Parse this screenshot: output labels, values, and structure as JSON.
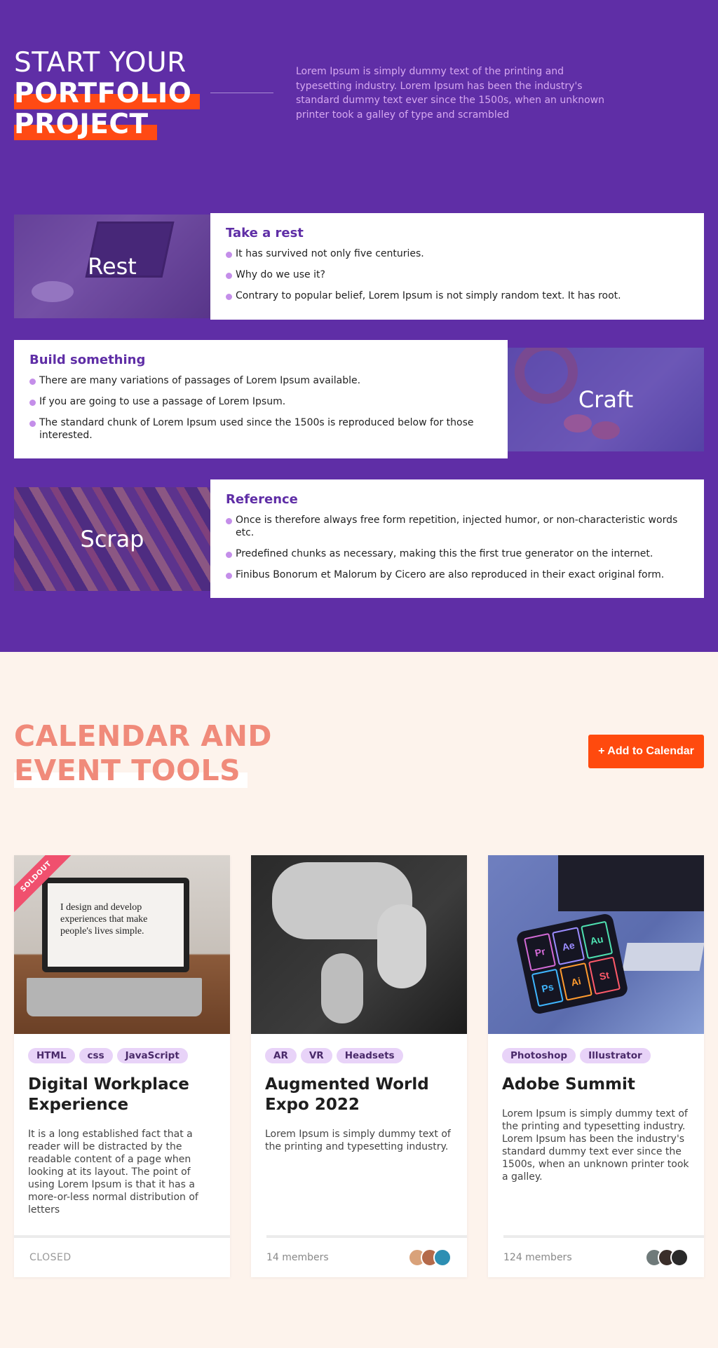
{
  "hero": {
    "title_line1": "START YOUR",
    "title_line2": "PORTFOLIO",
    "title_line3": "PROJECT",
    "description": "Lorem Ipsum is simply dummy text of the printing and typesetting industry. Lorem Ipsum has been the industry's standard dummy text ever since the 1500s, when an unknown printer took a galley of type and scrambled"
  },
  "features": [
    {
      "image_label": "Rest",
      "title": "Take a rest",
      "items": [
        "It has survived not only five centuries.",
        "Why do we use it?",
        "Contrary to popular belief, Lorem Ipsum is not simply random text. It has root."
      ]
    },
    {
      "image_label": "Craft",
      "title": "Build something",
      "items": [
        "There are many variations of passages of Lorem Ipsum available.",
        "If you are going to use a passage of Lorem Ipsum.",
        "The standard chunk of Lorem Ipsum used since the 1500s is reproduced below for those interested."
      ]
    },
    {
      "image_label": "Scrap",
      "title": "Reference",
      "items": [
        "Once is therefore always free form repetition, injected humor, or non-characteristic words etc.",
        "Predefined chunks as necessary, making this the first true generator on the internet.",
        "Finibus Bonorum et Malorum by Cicero are also reproduced in their exact original form."
      ]
    }
  ],
  "calendar": {
    "title_line1": "CALENDAR AND",
    "title_line2": "EVENT TOOLS",
    "add_button": "+ Add to Calendar"
  },
  "events": [
    {
      "ribbon": "SOLDOUT",
      "screen_text": "I design and develop experiences that make people's lives simple.",
      "tags": [
        "HTML",
        "css",
        "JavaScript"
      ],
      "title": "Digital Workplace Experience",
      "description": "It is a long established fact that a reader will be distracted by the readable content of a page when looking at its layout. The point of using Lorem Ipsum is that it has a more-or-less normal distribution of letters",
      "footer": "CLOSED"
    },
    {
      "tags": [
        "AR",
        "VR",
        "Headsets"
      ],
      "title": "Augmented World Expo 2022",
      "description": "Lorem Ipsum is simply dummy text of the printing and typesetting industry.",
      "footer": "14 members"
    },
    {
      "tags": [
        "Photoshop",
        "Illustrator"
      ],
      "title": "Adobe Summit",
      "description": "Lorem Ipsum is simply dummy text of the printing and typesetting industry. Lorem Ipsum has been the industry's standard dummy text ever since the 1500s, when an unknown printer took a galley.",
      "footer": "124 members",
      "app_tiles": [
        "Pr",
        "Ae",
        "Au",
        "Ps",
        "Ai",
        "St"
      ]
    }
  ],
  "colors": {
    "brand_purple": "#5f2ea6",
    "accent_orange": "#ff4a14",
    "calendar_title": "#f08a7a",
    "tag_bg": "#e8d3f8",
    "bullet": "#c48ee9"
  }
}
